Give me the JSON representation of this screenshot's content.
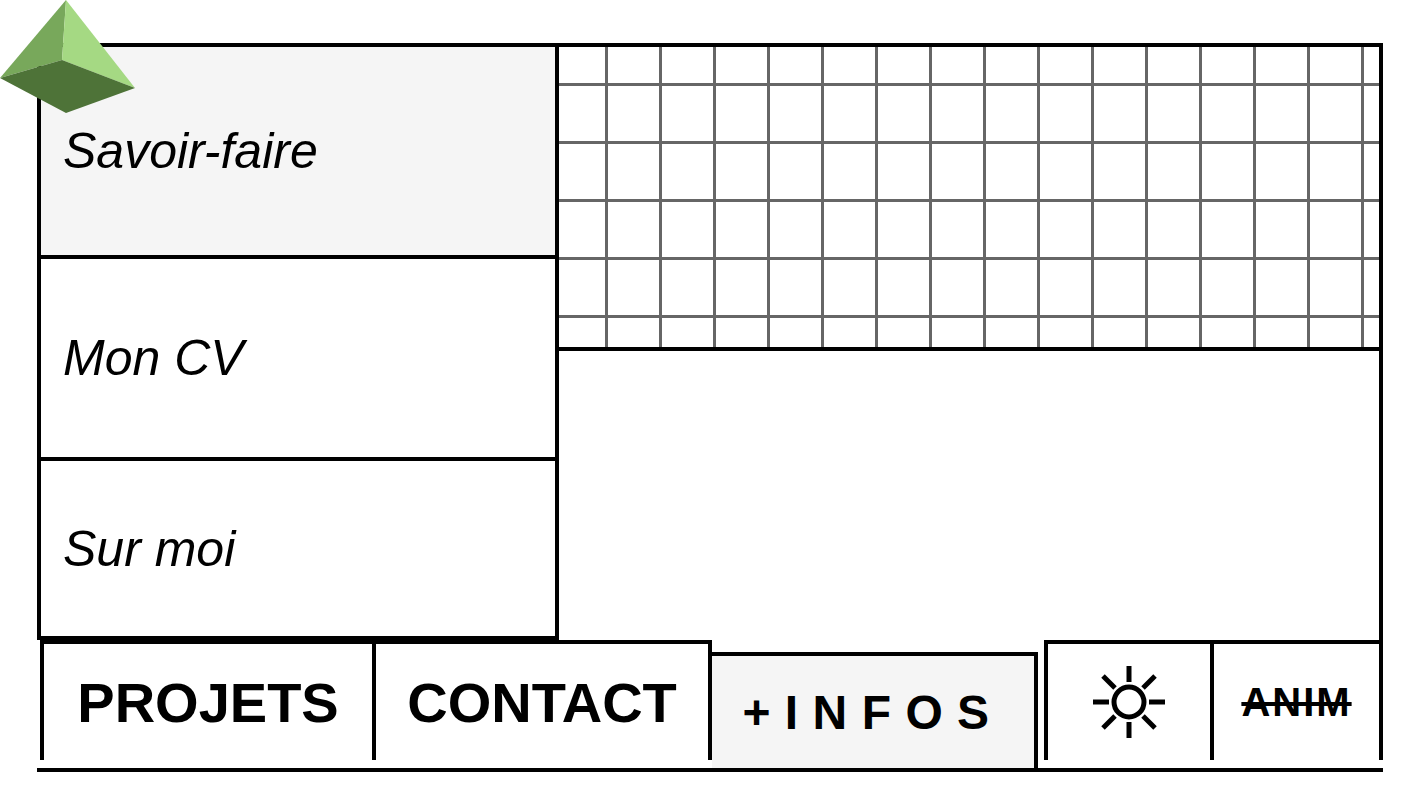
{
  "menu": {
    "items": [
      {
        "label": "Savoir-faire",
        "selected": true
      },
      {
        "label": "Mon CV",
        "selected": false
      },
      {
        "label": "Sur moi",
        "selected": false
      }
    ]
  },
  "bottom_bar": [
    {
      "kind": "link",
      "label": "PROJETS",
      "selected": false
    },
    {
      "kind": "link",
      "label": "CONTACT",
      "selected": false
    },
    {
      "kind": "spaced",
      "label": "+INFOS",
      "selected": true
    },
    {
      "kind": "theme",
      "label": "",
      "selected": false
    },
    {
      "kind": "toggle",
      "label": "ANIM",
      "selected": false,
      "on": false
    }
  ]
}
